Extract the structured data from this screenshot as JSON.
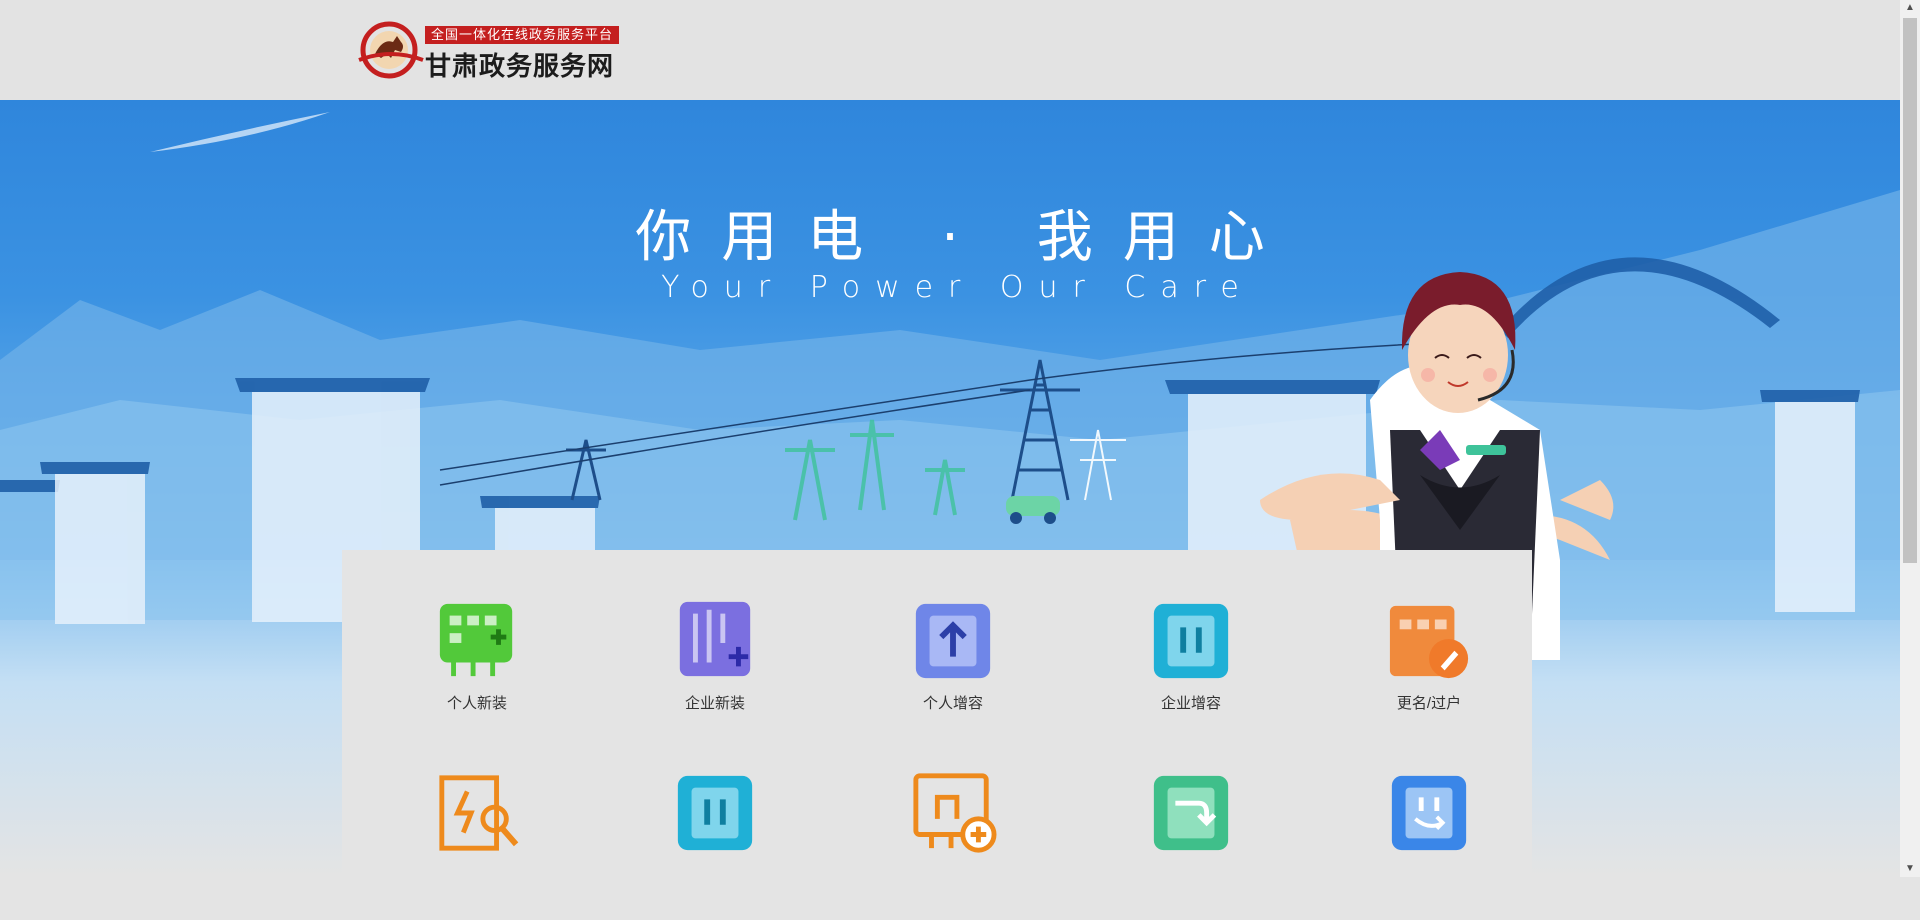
{
  "header": {
    "logo_tag": "全国一体化在线政务服务平台",
    "logo_name": "甘肃政务服务网"
  },
  "banner": {
    "slogan_cn": "你用电 · 我用心",
    "slogan_en": "Your Power Our Care"
  },
  "services": [
    {
      "label": "个人新装",
      "icon": "meter-add-icon",
      "color": "#52c93a"
    },
    {
      "label": "企业新装",
      "icon": "enterprise-meter-add-icon",
      "color": "#7b6fe0"
    },
    {
      "label": "个人增容",
      "icon": "capacity-up-icon",
      "color": "#6f86e8"
    },
    {
      "label": "企业增容",
      "icon": "enterprise-capacity-icon",
      "color": "#1fb0d6"
    },
    {
      "label": "更名/过户",
      "icon": "rename-transfer-icon",
      "color": "#f08a3c"
    },
    {
      "label": "",
      "icon": "power-repair-icon",
      "color": "#ee8a1c"
    },
    {
      "label": "",
      "icon": "meter-pause-icon",
      "color": "#1fb0d6"
    },
    {
      "label": "",
      "icon": "building-add-icon",
      "color": "#ee8a1c"
    },
    {
      "label": "",
      "icon": "meter-return-icon",
      "color": "#3fbf8a"
    },
    {
      "label": "",
      "icon": "meter-reset-icon",
      "color": "#3a86e8"
    }
  ]
}
